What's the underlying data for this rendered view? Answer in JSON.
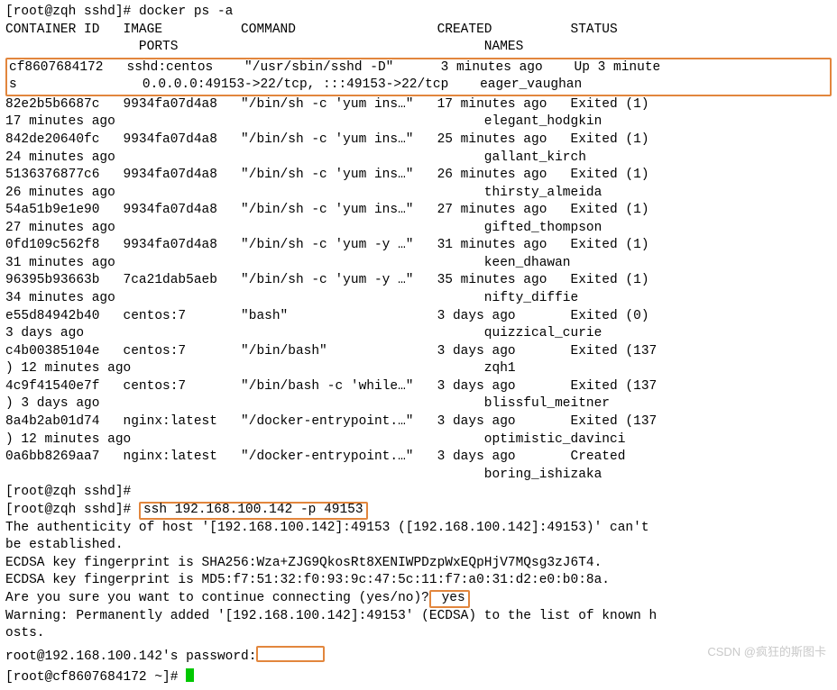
{
  "prompt1": "[root@zqh sshd]# ",
  "cmd1": "docker ps -a",
  "hdr1": "CONTAINER ID   IMAGE          COMMAND                  CREATED          STATUS",
  "hdr2": "                 PORTS                                       NAMES",
  "hi1": "cf8607684172   sshd:centos    \"/usr/sbin/sshd -D\"      3 minutes ago    Up 3 minute",
  "hi2": "s                0.0.0.0:49153->22/tcp, :::49153->22/tcp    eager_vaughan",
  "rows": [
    "82e2b5b6687c   9934fa07d4a8   \"/bin/sh -c 'yum ins…\"   17 minutes ago   Exited (1)",
    "17 minutes ago                                               elegant_hodgkin",
    "842de20640fc   9934fa07d4a8   \"/bin/sh -c 'yum ins…\"   25 minutes ago   Exited (1)",
    "24 minutes ago                                               gallant_kirch",
    "5136376877c6   9934fa07d4a8   \"/bin/sh -c 'yum ins…\"   26 minutes ago   Exited (1)",
    "26 minutes ago                                               thirsty_almeida",
    "54a51b9e1e90   9934fa07d4a8   \"/bin/sh -c 'yum ins…\"   27 minutes ago   Exited (1)",
    "27 minutes ago                                               gifted_thompson",
    "0fd109c562f8   9934fa07d4a8   \"/bin/sh -c 'yum -y …\"   31 minutes ago   Exited (1)",
    "31 minutes ago                                               keen_dhawan",
    "96395b93663b   7ca21dab5aeb   \"/bin/sh -c 'yum -y …\"   35 minutes ago   Exited (1)",
    "34 minutes ago                                               nifty_diffie",
    "e55d84942b40   centos:7       \"bash\"                   3 days ago       Exited (0)",
    "3 days ago                                                   quizzical_curie",
    "c4b00385104e   centos:7       \"/bin/bash\"              3 days ago       Exited (137",
    ") 12 minutes ago                                             zqh1",
    "4c9f41540e7f   centos:7       \"/bin/bash -c 'while…\"   3 days ago       Exited (137",
    ") 3 days ago                                                 blissful_meitner",
    "8a4b2ab01d74   nginx:latest   \"/docker-entrypoint.…\"   3 days ago       Exited (137",
    ") 12 minutes ago                                             optimistic_davinci",
    "0a6bb8269aa7   nginx:latest   \"/docker-entrypoint.…\"   3 days ago       Created",
    "                                                             boring_ishizaka"
  ],
  "empty_prompt": "[root@zqh sshd]#",
  "ssh_cmd": "ssh 192.168.100.142 -p 49153",
  "auth1": "The authenticity of host '[192.168.100.142]:49153 ([192.168.100.142]:49153)' can't",
  "auth2": "be established.",
  "fp1": "ECDSA key fingerprint is SHA256:Wza+ZJG9QkosRt8XENIWPDzpWxEQpHjV7MQsg3zJ6T4.",
  "fp2": "ECDSA key fingerprint is MD5:f7:51:32:f0:93:9c:47:5c:11:f7:a0:31:d2:e0:b0:8a.",
  "cont_pre": "Are you sure you want to continue connecting (yes/no)?",
  "cont_ans": " yes",
  "warn1": "Warning: Permanently added '[192.168.100.142]:49153' (ECDSA) to the list of known h",
  "warn2": "osts.",
  "pwd_prompt": "root@192.168.100.142's password:",
  "new_prompt": "[root@cf8607684172 ~]# ",
  "watermark": "CSDN @疯狂的斯图卡"
}
